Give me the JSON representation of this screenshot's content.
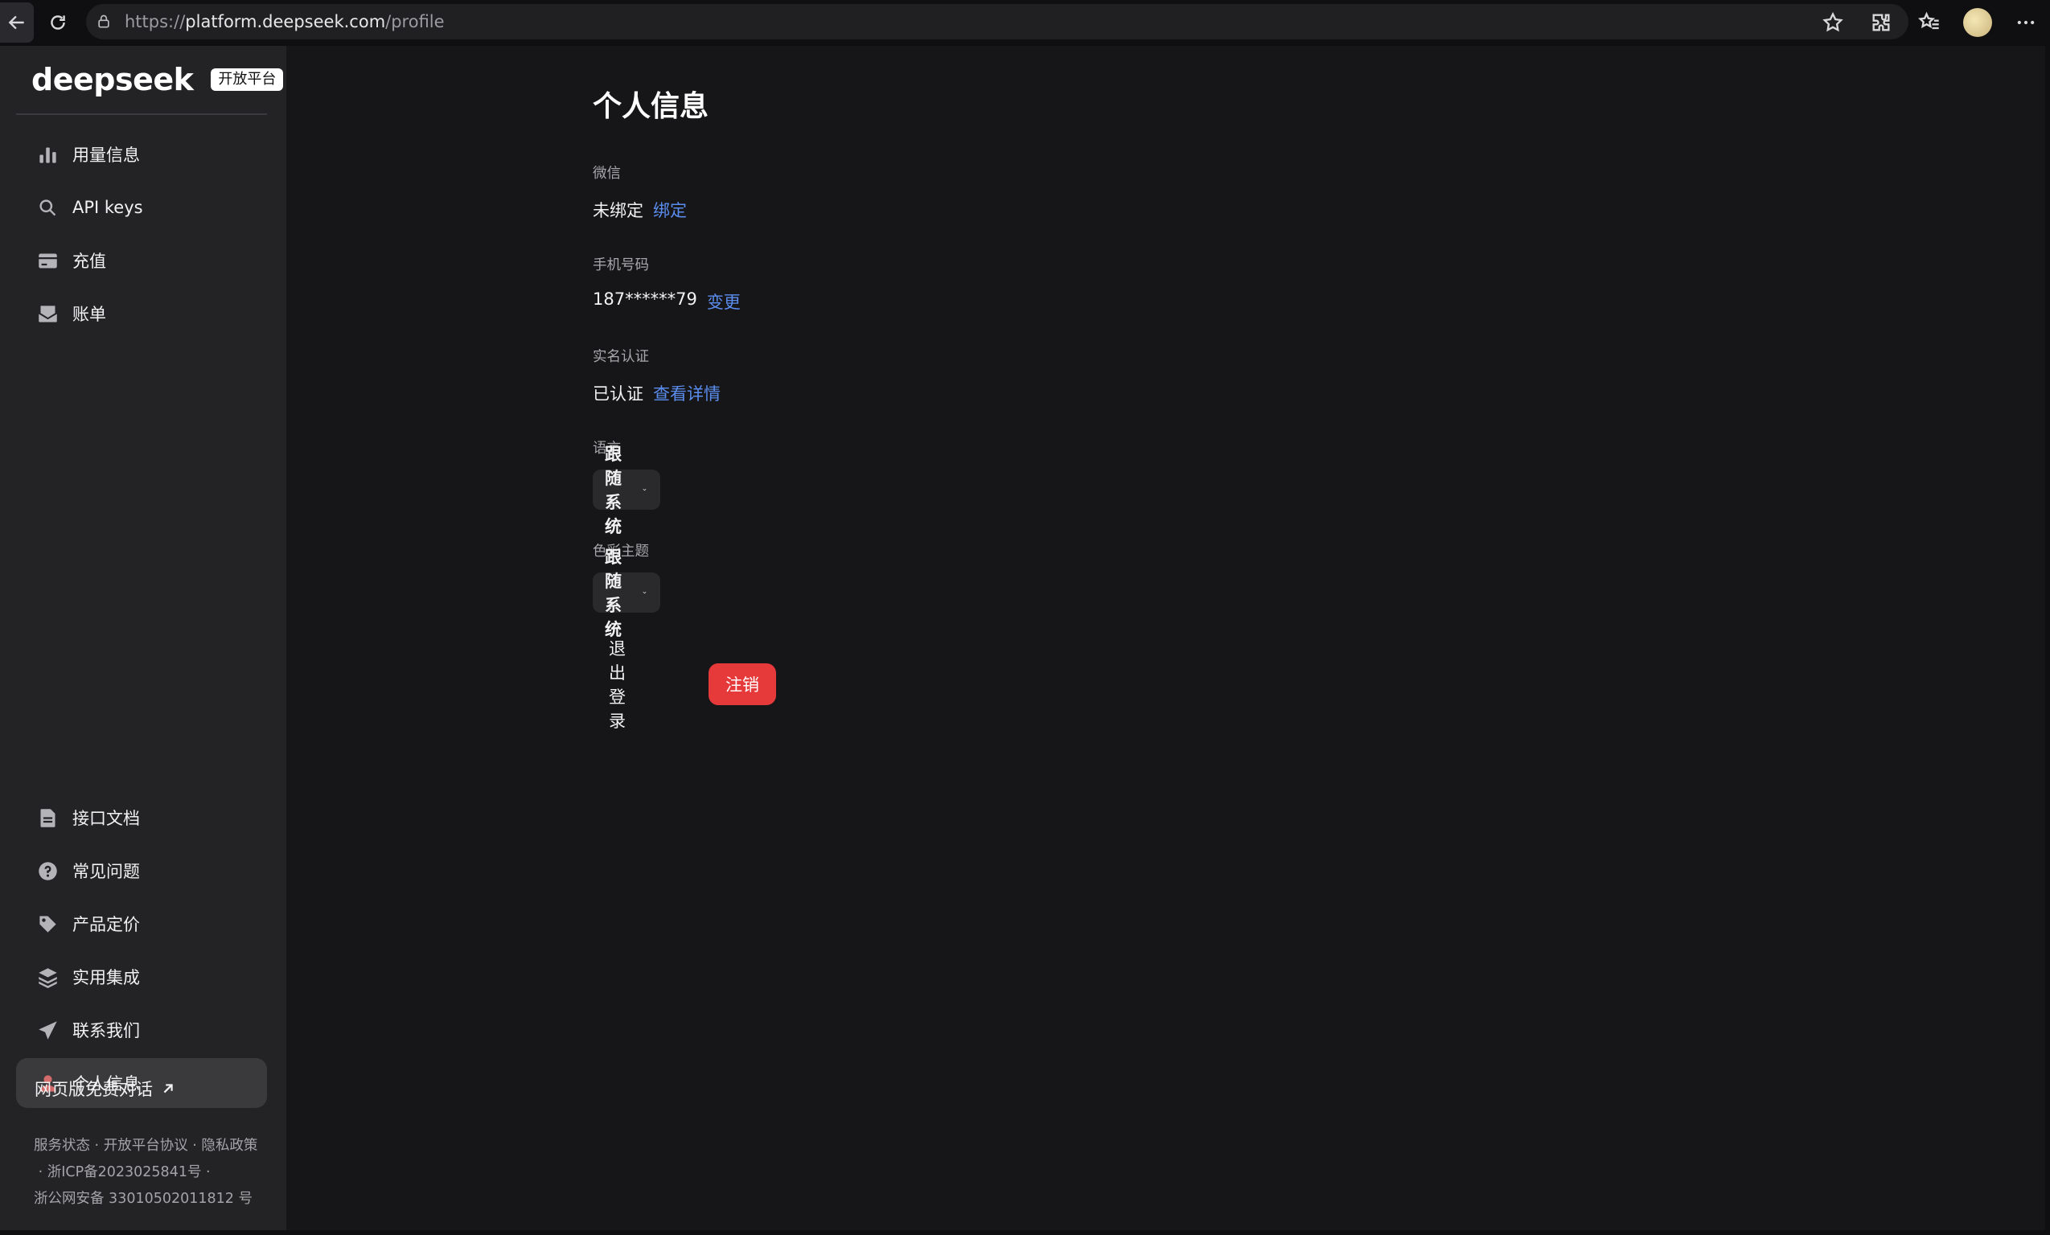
{
  "browser": {
    "url_prefix": "https://",
    "url_host": "platform.deepseek.com",
    "url_path": "/profile"
  },
  "sidebar": {
    "logo": "deepseek",
    "badge": "开放平台",
    "top_items": [
      {
        "label": "用量信息",
        "icon": "bar-chart-icon"
      },
      {
        "label": "API keys",
        "icon": "search-key-icon"
      },
      {
        "label": "充值",
        "icon": "card-icon"
      },
      {
        "label": "账单",
        "icon": "mailbox-icon"
      }
    ],
    "bottom_items": [
      {
        "label": "接口文档",
        "icon": "document-icon"
      },
      {
        "label": "常见问题",
        "icon": "question-icon"
      },
      {
        "label": "产品定价",
        "icon": "tag-icon"
      },
      {
        "label": "实用集成",
        "icon": "layers-icon"
      },
      {
        "label": "联系我们",
        "icon": "send-icon"
      },
      {
        "label": "个人信息",
        "icon": "user-icon",
        "active": true
      }
    ],
    "web_link": "网页版免费对话",
    "footer": {
      "line1": "服务状态 · 开放平台协议 · 隐私政策",
      "line2": " · 浙ICP备2023025841号 ·",
      "line3": "浙公网安备 33010502011812 号"
    }
  },
  "main": {
    "title": "个人信息",
    "wechat": {
      "label": "微信",
      "value": "未绑定",
      "action": "绑定"
    },
    "phone": {
      "label": "手机号码",
      "value": "187******79",
      "action": "变更"
    },
    "realname": {
      "label": "实名认证",
      "value": "已认证",
      "action": "查看详情"
    },
    "language": {
      "label": "语言",
      "value": "跟随系统"
    },
    "theme": {
      "label": "色彩主题",
      "value": "跟随系统"
    },
    "logout_label": "退出登录",
    "cancel_label": "注销"
  },
  "colors": {
    "accent_link": "#5b8def",
    "danger": "#e5393a",
    "active_user_icon": "#d46b6b"
  }
}
